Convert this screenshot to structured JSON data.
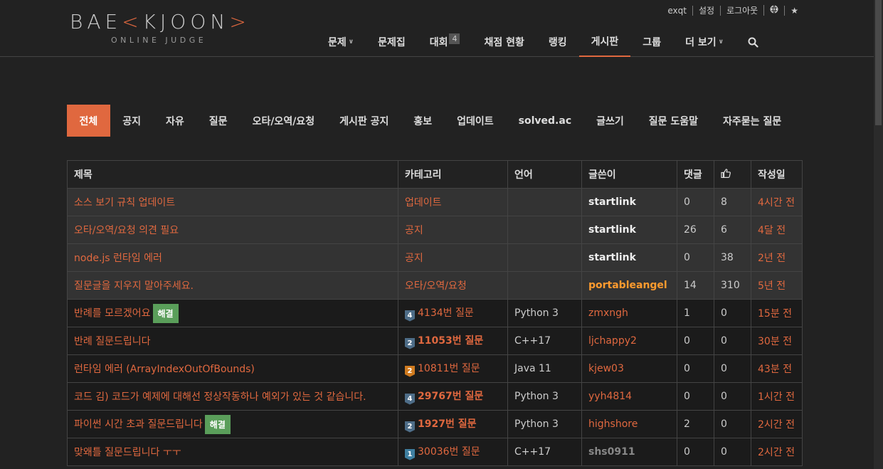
{
  "logo": {
    "main_left": "BAE",
    "main_mark": "K",
    "main_right": "JOON",
    "sub": "ONLINE JUDGE"
  },
  "toplinks": [
    "exqt",
    "설정",
    "로그아웃"
  ],
  "nav": [
    {
      "label": "문제",
      "dropdown": true
    },
    {
      "label": "문제집"
    },
    {
      "label": "대회",
      "badge": "4"
    },
    {
      "label": "채점 현황"
    },
    {
      "label": "랭킹"
    },
    {
      "label": "게시판",
      "active": true
    },
    {
      "label": "그룹"
    },
    {
      "label": "더 보기",
      "dropdown": true
    }
  ],
  "board_tabs": [
    "전체",
    "공지",
    "자유",
    "질문",
    "오타/오역/요청",
    "게시판 공지",
    "홍보",
    "업데이트",
    "solved.ac",
    "글쓰기",
    "질문 도움말",
    "자주묻는 질문"
  ],
  "table": {
    "headers": {
      "title": "제목",
      "category": "카테고리",
      "language": "언어",
      "author": "글쓴이",
      "comments": "댓글",
      "date": "작성일"
    },
    "rows": [
      {
        "title": "소스 보기 규칙 업데이트",
        "category": "업데이트",
        "language": "",
        "author": "startlink",
        "comments": "0",
        "likes": "8",
        "date": "4시간 전",
        "notice": true
      },
      {
        "title": "오타/오역/요청 의견 필요",
        "category": "공지",
        "language": "",
        "author": "startlink",
        "comments": "26",
        "likes": "6",
        "date": "4달 전",
        "notice": true
      },
      {
        "title": "node.js 런타임 에러",
        "category": "공지",
        "language": "",
        "author": "startlink",
        "comments": "0",
        "likes": "38",
        "date": "2년 전",
        "notice": true
      },
      {
        "title": "질문글을 지우지 말아주세요.",
        "category": "오타/오역/요청",
        "language": "",
        "author": "portableangel",
        "comments": "14",
        "likes": "310",
        "date": "5년 전",
        "notice": true
      },
      {
        "title": "반례를 모르겠어요",
        "solved": "해결",
        "tier": "4",
        "category": "4134번 질문",
        "language": "Python 3",
        "author": "zmxngh",
        "comments": "1",
        "likes": "0",
        "date": "15분 전"
      },
      {
        "title": "반례 질문드립니다",
        "tier": "2",
        "category": "11053번 질문",
        "language": "C++17",
        "author": "ljchappy2",
        "comments": "0",
        "likes": "0",
        "date": "30분 전"
      },
      {
        "title": "런타임 에러 (ArrayIndexOutOfBounds)",
        "tier": "2",
        "category": "10811번 질문",
        "language": "Java 11",
        "author": "kjew03",
        "comments": "0",
        "likes": "0",
        "date": "43분 전"
      },
      {
        "title": "코드 김) 코드가 예제에 대해선 정상작동하나 예외가 있는 것 같습니다.",
        "tier": "4",
        "category": "29767번 질문",
        "language": "Python 3",
        "author": "yyh4814",
        "comments": "0",
        "likes": "0",
        "date": "1시간 전"
      },
      {
        "title": "파이썬 시간 초과 질문드립니다",
        "solved": "해결",
        "tier": "2",
        "category": "1927번 질문",
        "language": "Python 3",
        "author": "highshore",
        "comments": "2",
        "likes": "0",
        "date": "2시간 전"
      },
      {
        "title": "맞왜틀 질문드립니다 ㅜㅜ",
        "tier": "1",
        "category": "30036번 질문",
        "language": "C++17",
        "author": "shs0911",
        "comments": "0",
        "likes": "0",
        "date": "2시간 전"
      }
    ]
  },
  "colors": {
    "accent": "#e0683f",
    "solved": "#5a9e5a",
    "admin": "#ff9b2e"
  }
}
